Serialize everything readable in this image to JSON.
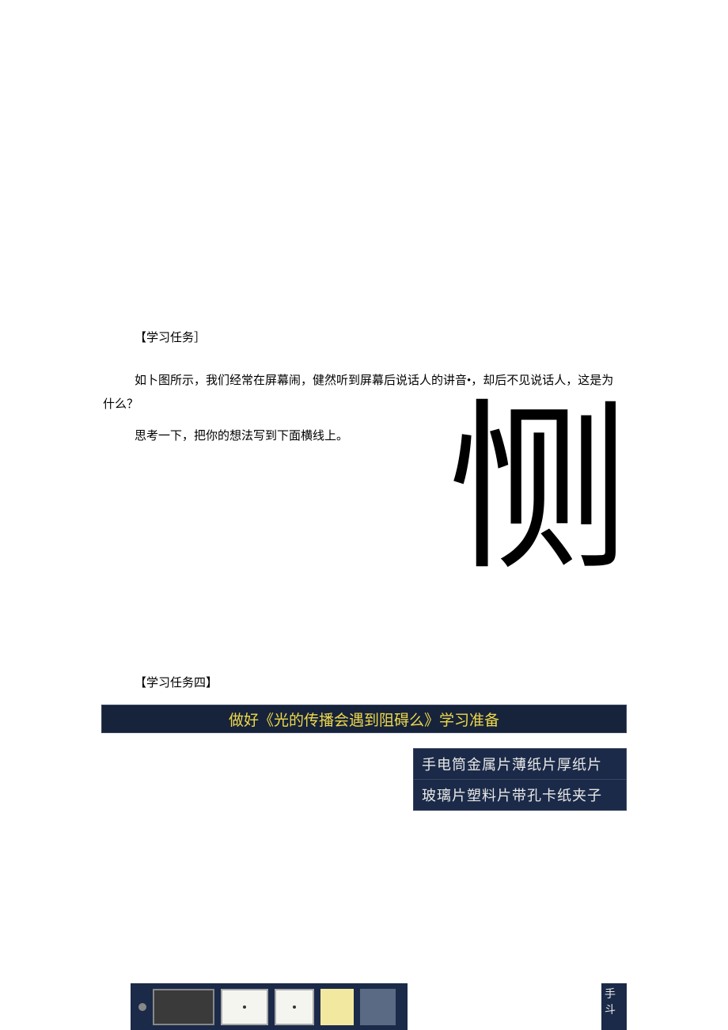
{
  "section1": {
    "heading": "【学习任务］",
    "para1_a": "如卜图所示，我们经常在屏幕闹，健然听到屏幕后说话人的讲音",
    "para1_dot": "•",
    "para1_b": "，却后不见说话人，这是为什么？",
    "para2": "思考一下，把你的想法写到下面横线上。"
  },
  "big_char": "恻",
  "section2": {
    "heading": "【学习任务四】"
  },
  "banner": {
    "text": "做好《光的传播会遇到阻碍么》学习准备"
  },
  "materials": {
    "row1": "手电筒金属片薄纸片厚纸片",
    "row2": "玻璃片塑料片带孔卡纸夹子"
  },
  "bottom_right": "手斗"
}
